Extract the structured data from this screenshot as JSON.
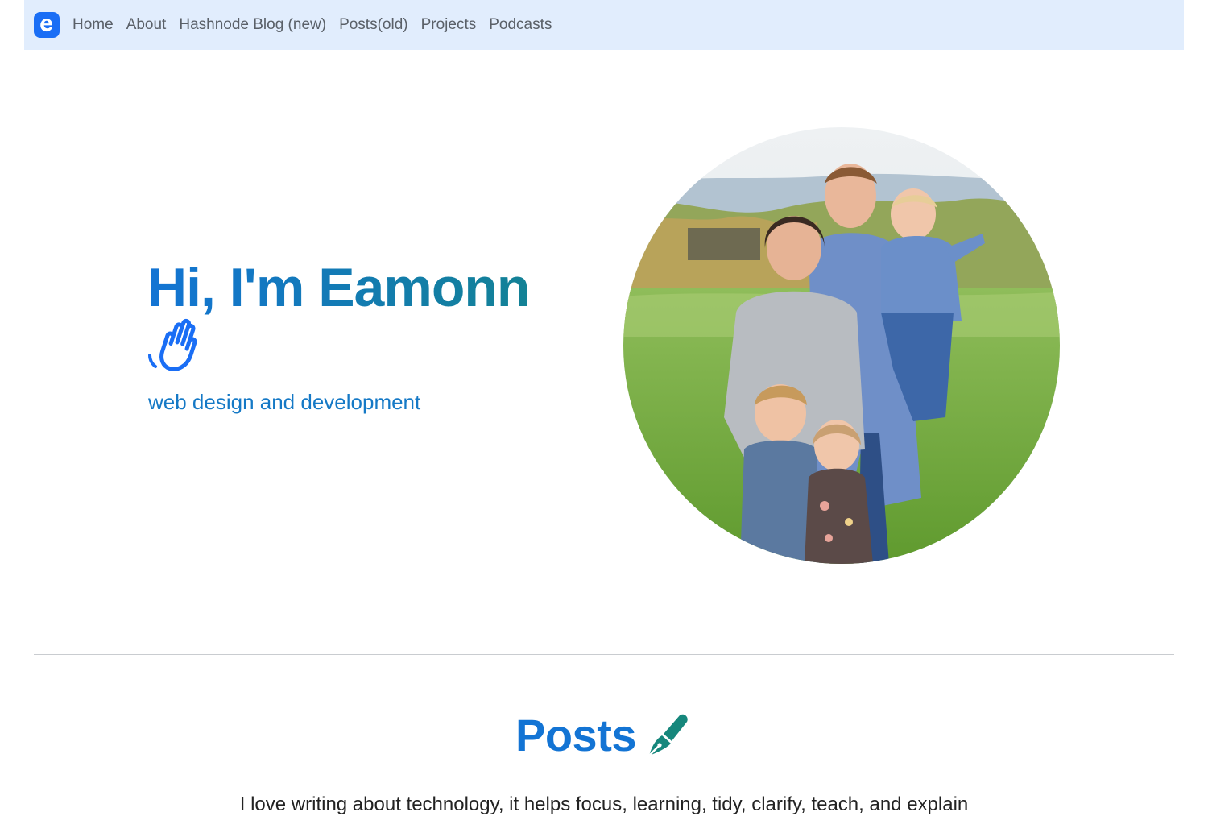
{
  "nav": {
    "brand_icon": "e-logo-icon",
    "links": [
      "Home",
      "About",
      "Hashnode Blog (new)",
      "Posts(old)",
      "Projects",
      "Podcasts"
    ]
  },
  "hero": {
    "title": "Hi, I'm Eamonn",
    "wave_icon": "waving-hand-icon",
    "subtitle": "web design and development",
    "photo_alt": "family photo"
  },
  "posts": {
    "title": "Posts",
    "icon": "fountain-pen-icon",
    "intro": "I love writing about technology, it helps focus, learning, tidy, clarify, teach, and explain"
  },
  "colors": {
    "accent": "#1374d4",
    "teal": "#13848a",
    "nav_bg": "#e1edfd"
  }
}
